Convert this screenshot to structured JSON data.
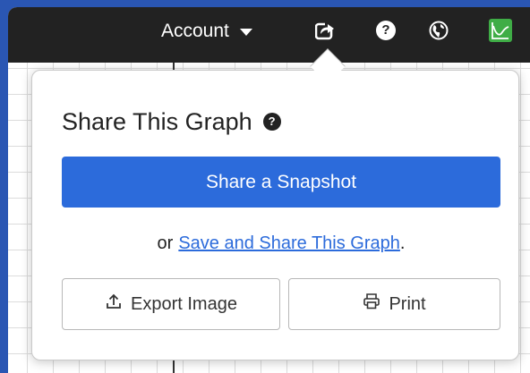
{
  "toolbar": {
    "account_label": "Account",
    "icons": [
      "share-icon",
      "help-icon",
      "globe-icon",
      "graph-logo-icon"
    ]
  },
  "share_popover": {
    "title": "Share This Graph",
    "help_glyph": "?",
    "snapshot_button_label": "Share a Snapshot",
    "or_text": "or",
    "save_link_text": "Save and Share This Graph",
    "trailing_period": ".",
    "export_button_label": "Export Image",
    "print_button_label": "Print"
  },
  "colors": {
    "desktop_background": "#2a56b3",
    "toolbar_background": "#222222",
    "primary_blue": "#2c6bdb",
    "logo_green": "#3fad46"
  }
}
